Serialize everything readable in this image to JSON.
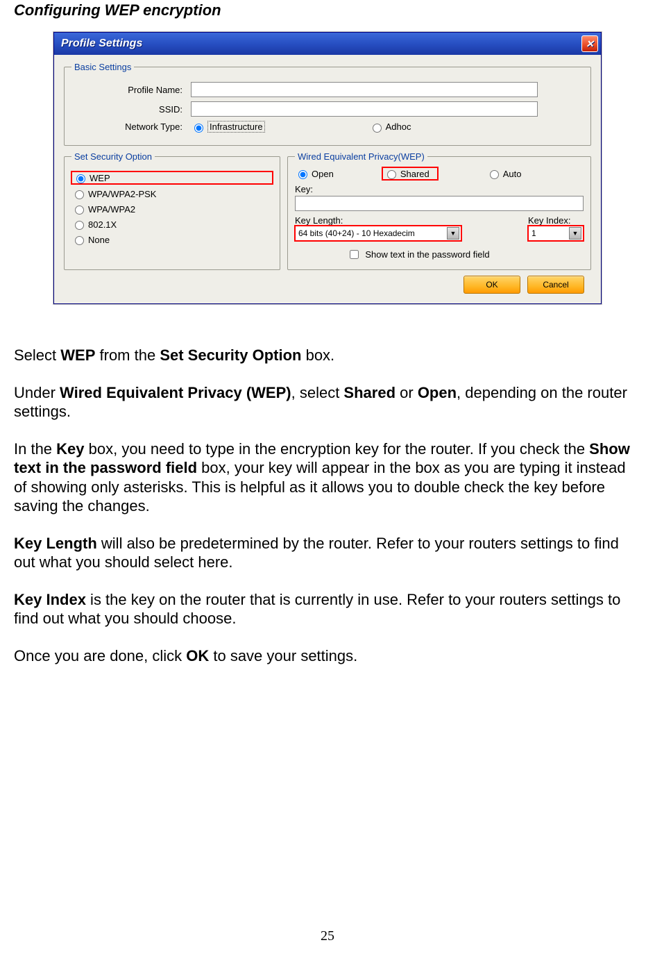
{
  "page_heading": "Configuring WEP encryption",
  "page_number": "25",
  "screenshot": {
    "title": "Profile Settings",
    "basic": {
      "legend": "Basic Settings",
      "labels": {
        "profile_name": "Profile Name:",
        "ssid": "SSID:",
        "network_type": "Network Type:"
      },
      "network_type": {
        "infrastructure": "Infrastructure",
        "adhoc": "Adhoc"
      }
    },
    "security": {
      "legend": "Set Security Option",
      "options": {
        "wep": "WEP",
        "wpa_psk": "WPA/WPA2-PSK",
        "wpa": "WPA/WPA2",
        "dot1x": "802.1X",
        "none": "None"
      }
    },
    "wep_panel": {
      "legend": "Wired Equivalent Privacy(WEP)",
      "auth": {
        "open": "Open",
        "shared": "Shared",
        "auto": "Auto"
      },
      "key_label": "Key:",
      "key_length_label": "Key Length:",
      "key_length_value": "64 bits (40+24) - 10 Hexadecim",
      "key_index_label": "Key Index:",
      "key_index_value": "1",
      "show_text_checkbox": "Show text in the password field"
    },
    "buttons": {
      "ok": "OK",
      "cancel": "Cancel"
    }
  },
  "body_text": {
    "p1_a": "Select ",
    "p1_b": "WEP",
    "p1_c": " from the ",
    "p1_d": "Set Security Option",
    "p1_e": " box.",
    "p2_a": "Under ",
    "p2_b": "Wired Equivalent Privacy (WEP)",
    "p2_c": ", select ",
    "p2_d": "Shared",
    "p2_e": " or ",
    "p2_f": "Open",
    "p2_g": ", depending on the router settings.",
    "p3_a": "In the ",
    "p3_b": "Key",
    "p3_c": " box, you need to type in the encryption key for the router.  If you check the ",
    "p3_d": "Show text in the password field",
    "p3_e": " box, your key will appear in the box as you are typing it instead of showing only asterisks.  This is helpful as it allows you to double check the key before saving the changes.",
    "p4_a": "Key Length",
    "p4_b": " will also be predetermined by the router.  Refer to your routers settings to find out what you should select here.",
    "p5_a": "Key Index",
    "p5_b": " is the key on the router that is currently in use.  Refer to your routers settings to find out what you should choose.",
    "p6_a": "Once you are done, click ",
    "p6_b": "OK",
    "p6_c": " to save your settings."
  }
}
